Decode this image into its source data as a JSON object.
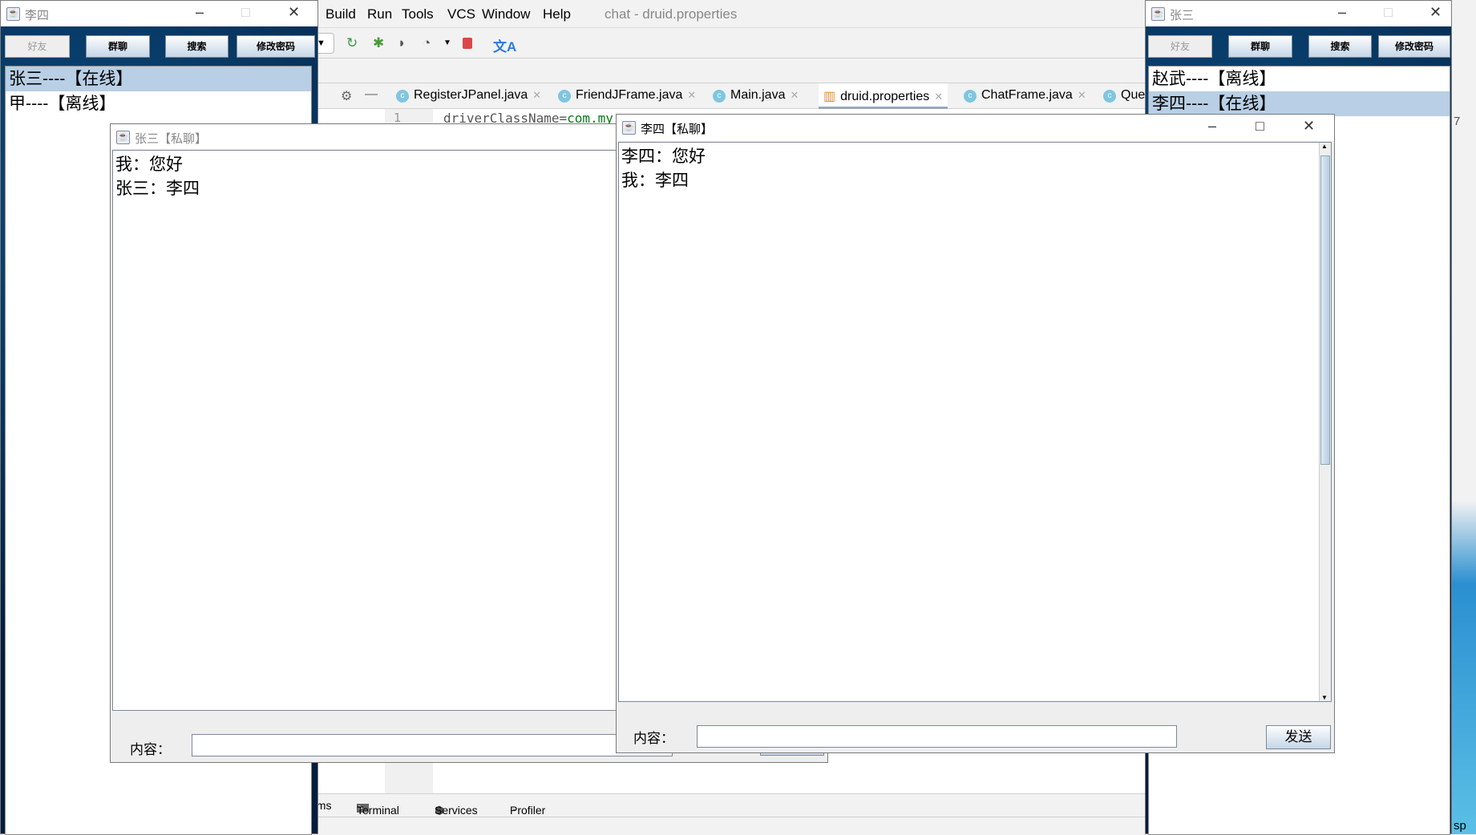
{
  "ide": {
    "menu": [
      "Build",
      "Run",
      "Tools",
      "VCS",
      "Window",
      "Help"
    ],
    "title": "chat - druid.properties",
    "tabs": [
      {
        "label": "RegisterJPanel.java"
      },
      {
        "label": "FriendJFrame.java"
      },
      {
        "label": "Main.java"
      },
      {
        "label": "druid.properties",
        "active": true
      },
      {
        "label": "ChatFrame.java"
      },
      {
        "label": "Que"
      }
    ],
    "line_number": "1",
    "code": {
      "key": "driverClassName=",
      "value": "com.my"
    },
    "bottom": [
      "ems",
      "Terminal",
      "Services",
      "Profiler"
    ],
    "right_fragment_top": "7",
    "right_fragment_bottom": "sp"
  },
  "lisi_main": {
    "title": "李四",
    "buttons": [
      "好友",
      "群聊",
      "搜索",
      "修改密码"
    ],
    "friends": [
      {
        "label": "张三----【在线】",
        "selected": true
      },
      {
        "label": "甲----【离线】"
      }
    ]
  },
  "zhangsan_main": {
    "title": "张三",
    "buttons": [
      "好友",
      "群聊",
      "搜索",
      "修改密码"
    ],
    "friends": [
      {
        "label": "赵武----【离线】"
      },
      {
        "label": "李四----【在线】",
        "selected": true
      }
    ]
  },
  "chat_zhangsan": {
    "title": "张三【私聊】",
    "messages": [
      "我：您好",
      "张三：李四"
    ],
    "content_label": "内容：",
    "input_value": ""
  },
  "chat_lisi": {
    "title": "李四【私聊】",
    "messages": [
      "李四：您好",
      "我：李四"
    ],
    "content_label": "内容：",
    "input_value": "",
    "send_label": "发送"
  }
}
